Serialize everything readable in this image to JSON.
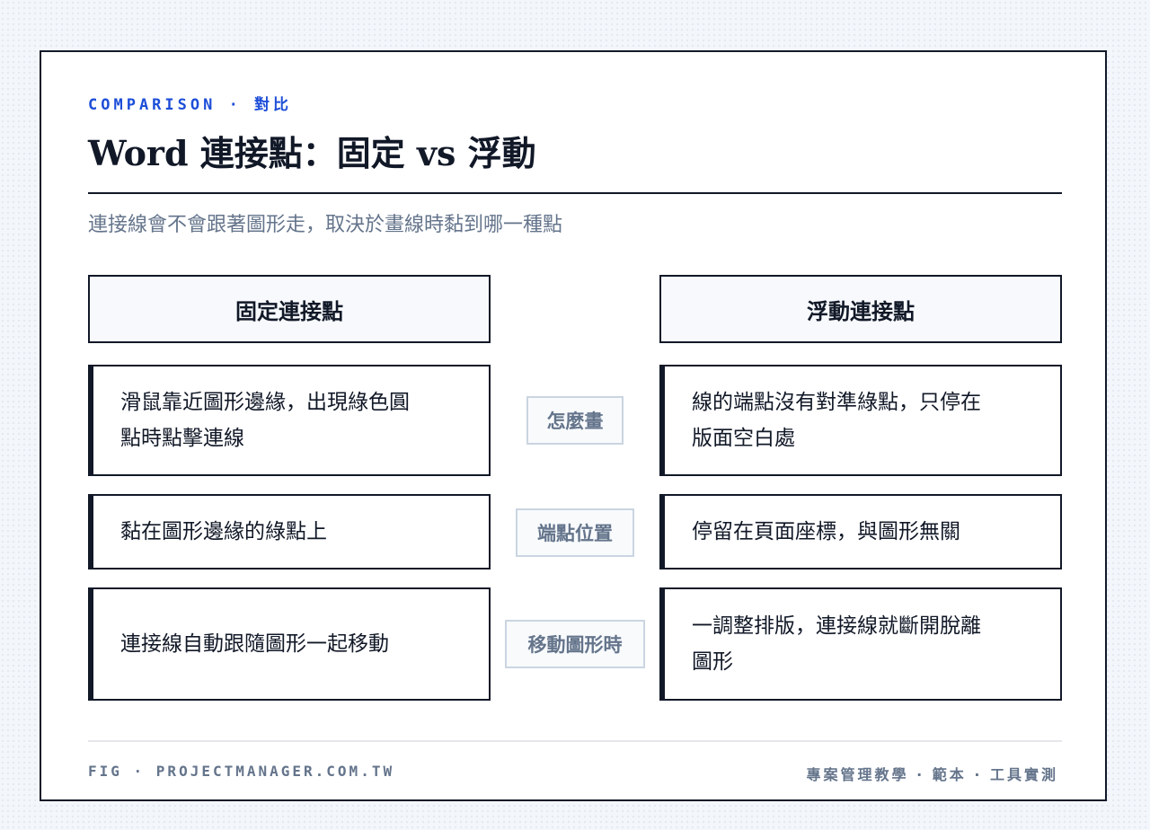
{
  "eyebrow": "COMPARISON · 對比",
  "title": "Word 連接點：固定 vs 浮動",
  "subtitle": "連接線會不會跟著圖形走，取決於畫線時黏到哪一種點",
  "columns": {
    "left": "固定連接點",
    "right": "浮動連接點"
  },
  "rows": [
    {
      "label": "怎麼畫",
      "left": [
        "滑鼠靠近圖形邊緣，出現綠色圓",
        "點時點擊連線"
      ],
      "right": [
        "線的端點沒有對準綠點，只停在",
        "版面空白處"
      ]
    },
    {
      "label": "端點位置",
      "left": [
        "黏在圖形邊緣的綠點上"
      ],
      "right": [
        "停留在頁面座標，與圖形無關"
      ]
    },
    {
      "label": "移動圖形時",
      "left": [
        "連接線自動跟隨圖形一起移動"
      ],
      "right": [
        "一調整排版，連接線就斷開脫離",
        "圖形"
      ]
    }
  ],
  "footer": {
    "left": "FIG · PROJECTMANAGER.COM.TW",
    "right": "專案管理教學 · 範本 · 工具實測"
  }
}
